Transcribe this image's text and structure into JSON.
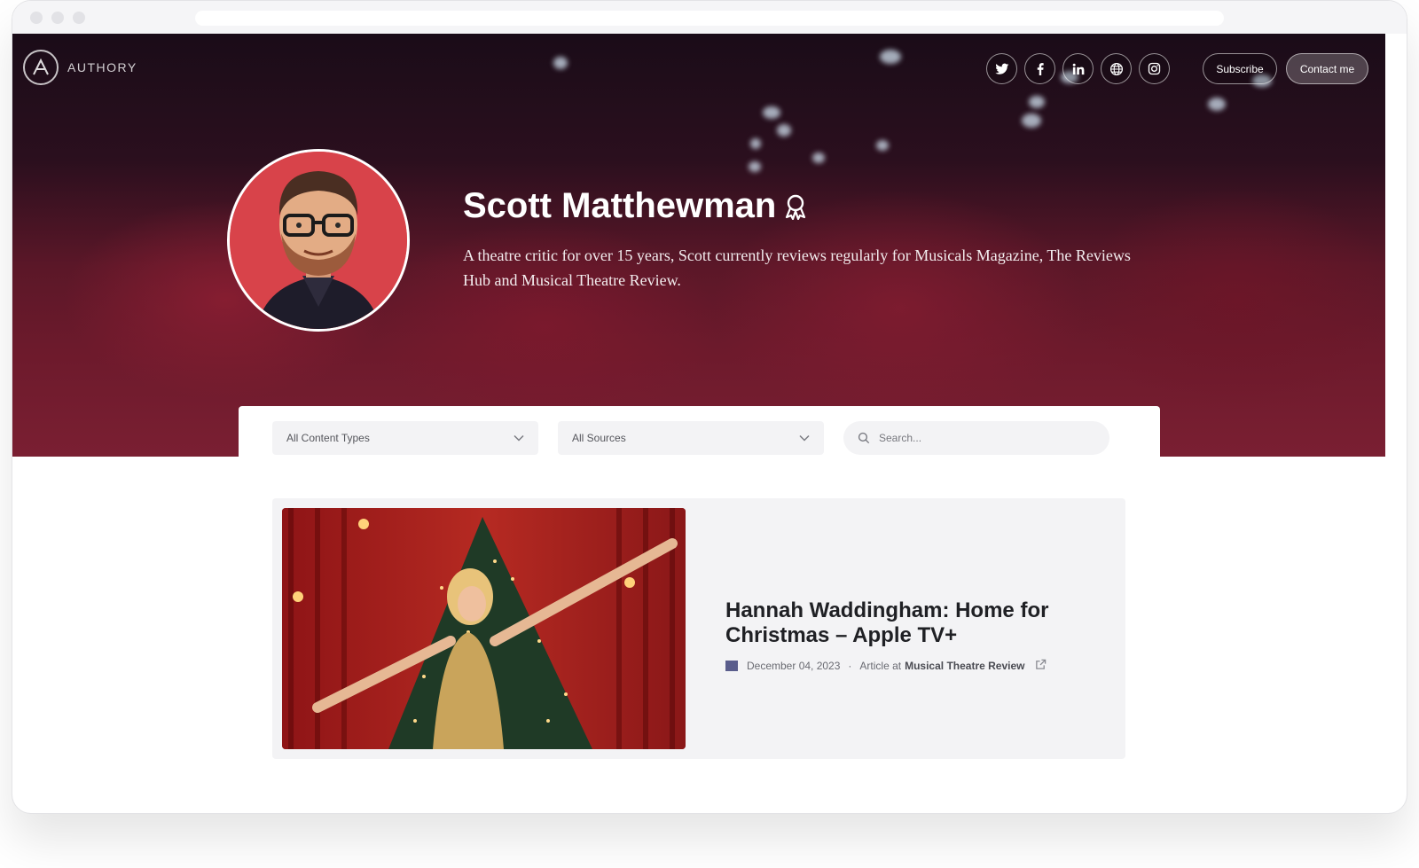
{
  "brand": {
    "logo_text": "AUTHORY"
  },
  "nav": {
    "social_icons": [
      "twitter-icon",
      "facebook-icon",
      "linkedin-icon",
      "globe-icon",
      "instagram-icon"
    ],
    "subscribe_label": "Subscribe",
    "contact_label": "Contact me"
  },
  "profile": {
    "name": "Scott Matthewman",
    "bio": "A theatre critic for over 15 years, Scott currently reviews regularly for Musicals Magazine, The Reviews Hub and Musical Theatre Review."
  },
  "filters": {
    "content_types_selected": "All Content Types",
    "sources_selected": "All Sources",
    "search_placeholder": "Search..."
  },
  "articles": [
    {
      "title": "Hannah Waddingham: Home for Christmas – Apple TV+",
      "date": "December 04, 2023",
      "meta_type": "Article at",
      "source": "Musical Theatre Review"
    }
  ],
  "colors": {
    "hero_dark": "#1a0c18",
    "hero_red": "#7a1f32",
    "card_bg": "#f3f3f5",
    "avatar_bg": "#d8434a"
  }
}
